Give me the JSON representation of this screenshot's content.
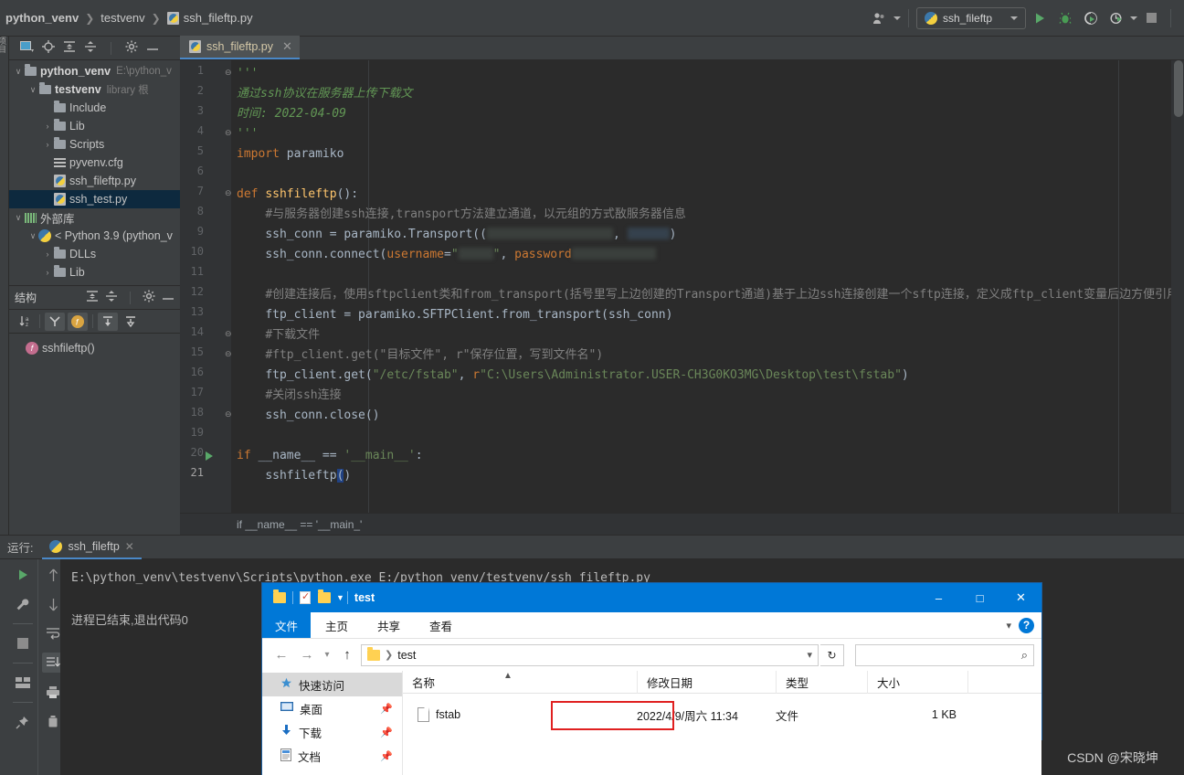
{
  "topbar": {
    "breadcrumbs": [
      "python_venv",
      "testvenv",
      "ssh_fileftp.py"
    ],
    "run_config": "ssh_fileftp",
    "icons": [
      "user-profile-icon",
      "run-icon",
      "debug-icon",
      "coverage-icon",
      "profile-icon",
      "stop-icon"
    ]
  },
  "left_rail": {
    "label": "项目"
  },
  "project_panel": {
    "title": "项目",
    "tree": [
      {
        "label": "python_venv",
        "detail": "E:\\python_v",
        "icon": "folder-icon",
        "chevron": "∨",
        "indent": 0,
        "bold": true,
        "selected": false
      },
      {
        "label": "testvenv",
        "detail": "library 根",
        "icon": "folder-icon",
        "chevron": "∨",
        "indent": 1,
        "bold": true,
        "selected": false
      },
      {
        "label": "Include",
        "detail": "",
        "icon": "folder-icon",
        "chevron": "",
        "indent": 2,
        "bold": false,
        "selected": false
      },
      {
        "label": "Lib",
        "detail": "",
        "icon": "folder-icon",
        "chevron": "›",
        "indent": 2,
        "bold": false,
        "selected": false
      },
      {
        "label": "Scripts",
        "detail": "",
        "icon": "folder-icon",
        "chevron": "›",
        "indent": 2,
        "bold": false,
        "selected": false
      },
      {
        "label": "pyvenv.cfg",
        "detail": "",
        "icon": "config-file-icon",
        "chevron": "",
        "indent": 2,
        "bold": false,
        "selected": false
      },
      {
        "label": "ssh_fileftp.py",
        "detail": "",
        "icon": "python-file-icon",
        "chevron": "",
        "indent": 2,
        "bold": false,
        "selected": false
      },
      {
        "label": "ssh_test.py",
        "detail": "",
        "icon": "python-file-icon",
        "chevron": "",
        "indent": 2,
        "bold": false,
        "selected": true
      },
      {
        "label": "外部库",
        "detail": "",
        "icon": "library-icon",
        "chevron": "∨",
        "indent": 0,
        "bold": false,
        "selected": false
      },
      {
        "label": "< Python 3.9 (python_v",
        "detail": "",
        "icon": "python-icon",
        "chevron": "∨",
        "indent": 1,
        "bold": false,
        "selected": false
      },
      {
        "label": "DLLs",
        "detail": "",
        "icon": "folder-icon",
        "chevron": "›",
        "indent": 2,
        "bold": false,
        "selected": false
      },
      {
        "label": "Lib",
        "detail": "",
        "icon": "folder-icon",
        "chevron": "›",
        "indent": 2,
        "bold": false,
        "selected": false
      }
    ]
  },
  "structure_panel": {
    "title": "结构",
    "items": [
      {
        "label": "sshfileftp()",
        "badge": "f"
      }
    ]
  },
  "editor": {
    "tab": "ssh_fileftp.py",
    "breadcrumb": "if __name__ == '__main_'",
    "lines": [
      {
        "n": 1,
        "html": "<span class=\"cdoc\">'''</span>"
      },
      {
        "n": 2,
        "html": "<span class=\"cdoc\">通过ssh协议在服务器上传下载文</span>"
      },
      {
        "n": 3,
        "html": "<span class=\"cdoc\">时间: 2022-04-09</span>"
      },
      {
        "n": 4,
        "html": "<span class=\"cdoc\">'''</span>"
      },
      {
        "n": 5,
        "html": "<span class=\"k\">import</span> <span class=\"d\">paramiko</span>"
      },
      {
        "n": 6,
        "html": ""
      },
      {
        "n": 7,
        "html": "<span class=\"k\">def</span> <span class=\"fn\">sshfileftp</span><span class=\"d\">():</span>"
      },
      {
        "n": 8,
        "html": "    <span class=\"c\">#与服务器创建ssh连接,transport方法建立通道，以元组的方式敔服务器信息</span>"
      },
      {
        "n": 9,
        "html": "    <span class=\"d\">ssh_conn = paramiko.Transport((</span><span class=\"redact\" style=\"width:138px\"></span><span class=\"d\">, </span><span class=\"redact b\" style=\"width:46px\"></span><span class=\"d\">)</span>"
      },
      {
        "n": 10,
        "html": "    <span class=\"d\">ssh_conn.connect(</span><span class=\"kw2\" style=\"color:#cc7832\">username</span><span class=\"d\">=</span><span class=\"s\">\"</span><span class=\"redact\" style=\"width:38px\"></span><span class=\"s\">\"</span><span class=\"d\">, </span><span class=\"kw2\" style=\"color:#cc7832\">password</span><span class=\"redact\" style=\"width:92px\"></span>"
      },
      {
        "n": 11,
        "html": ""
      },
      {
        "n": 12,
        "html": "    <span class=\"c\">#创建连接后，使用sftpclient类和from_transport(括号里写上边创建的Transport通道)基于上边ssh连接创建一个sftp连接，定义成ftp_client变量后边方便引用</span>"
      },
      {
        "n": 13,
        "html": "    <span class=\"d\">ftp_client = paramiko.SFTPClient.from_transport(ssh_conn)</span>"
      },
      {
        "n": 14,
        "html": "    <span class=\"c\">#下载文件</span>"
      },
      {
        "n": 15,
        "html": "    <span class=\"c\">#ftp_client.get(\"目标文件\", r\"保存位置，写到文件名\")</span>"
      },
      {
        "n": 16,
        "html": "    <span class=\"d\">ftp_client.get(</span><span class=\"s\">\"/etc/fstab\"</span><span class=\"d\">, </span><span class=\"k\">r</span><span class=\"s\">\"C:\\Users\\Administrator.USER-CH3G0KO3MG\\Desktop\\test\\fstab\"</span><span class=\"d\">)</span>"
      },
      {
        "n": 17,
        "html": "    <span class=\"c\">#关闭ssh连接</span>"
      },
      {
        "n": 18,
        "html": "    <span class=\"d\">ssh_conn.close()</span>"
      },
      {
        "n": 19,
        "html": ""
      },
      {
        "n": 20,
        "html": "<span class=\"k\">if</span> <span class=\"d\">__name__ == </span><span class=\"s\">'__main__'</span><span class=\"d\">:</span>"
      },
      {
        "n": 21,
        "html": "    <span class=\"d\">sshfileftp</span><span class=\"selhl\"><span class=\"d\">(</span></span><span class=\"d\">)</span>"
      }
    ]
  },
  "run_panel": {
    "label": "运行:",
    "tab": "ssh_fileftp",
    "console_command": "E:\\python_venv\\testvenv\\Scripts\\python.exe E:/python_venv/testvenv/ssh_fileftp.py",
    "console_result": "进程已结束,退出代码0",
    "toolbar_left": [
      "rerun-icon",
      "settings-wrench-icon",
      "stop-icon",
      "layout-icon",
      "pin-icon"
    ],
    "toolbar_right": [
      "up-arrow-icon",
      "down-arrow-icon",
      "soft-wrap-icon",
      "scroll-to-end-icon",
      "print-icon",
      "trash-icon"
    ]
  },
  "explorer": {
    "title": "test",
    "window_buttons": [
      "minimize",
      "maximize",
      "close"
    ],
    "ribbon": {
      "file": "文件",
      "tabs": [
        "主页",
        "共享",
        "查看"
      ]
    },
    "address": "test",
    "search_placeholder": "",
    "nav_items": [
      {
        "label": "快速访问",
        "icon": "star-icon",
        "pinned": false,
        "selected": true
      },
      {
        "label": "桌面",
        "icon": "desktop-icon",
        "pinned": true,
        "selected": false
      },
      {
        "label": "下载",
        "icon": "download-icon",
        "pinned": true,
        "selected": false
      },
      {
        "label": "文档",
        "icon": "documents-icon",
        "pinned": true,
        "selected": false
      }
    ],
    "columns": [
      "名称",
      "修改日期",
      "类型",
      "大小"
    ],
    "rows": [
      {
        "name": "fstab",
        "modified": "2022/4/9/周六 11:34",
        "type": "文件",
        "size": "1 KB",
        "highlighted": true
      }
    ]
  },
  "watermark": "CSDN @宋晓坤",
  "colors": {
    "accent": "#0078d7",
    "ide_bg": "#3c3f41",
    "editor_bg": "#2b2b2b",
    "highlight_red": "#e02020",
    "run_green": "#59a869"
  }
}
